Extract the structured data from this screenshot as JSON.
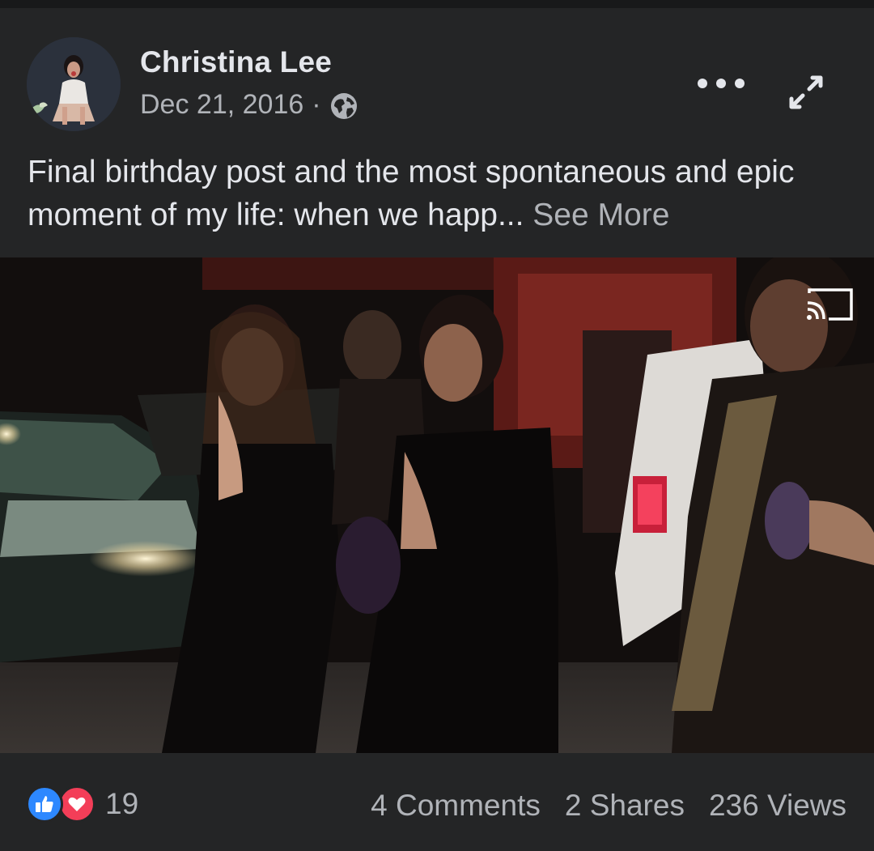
{
  "post": {
    "author": "Christina Lee",
    "date": "Dec 21, 2016",
    "separator": "·",
    "privacy_icon": "globe-icon",
    "text": "Final birthday post and the most spontaneous and epic moment of my life: when we happ...",
    "see_more": "See More"
  },
  "header_actions": {
    "more_icon": "more-dots-icon",
    "expand_icon": "expand-arrows-icon"
  },
  "media": {
    "type": "video",
    "cast_icon": "cast-icon"
  },
  "footer": {
    "reaction_icons": [
      "like-icon",
      "love-icon"
    ],
    "reaction_count": "19",
    "comments": "4 Comments",
    "shares": "2 Shares",
    "views": "236 Views"
  },
  "colors": {
    "background": "#242526",
    "text_primary": "#e4e6eb",
    "text_secondary": "#b0b3b8",
    "like_blue": "#2d88ff",
    "love_red": "#f33e58"
  }
}
